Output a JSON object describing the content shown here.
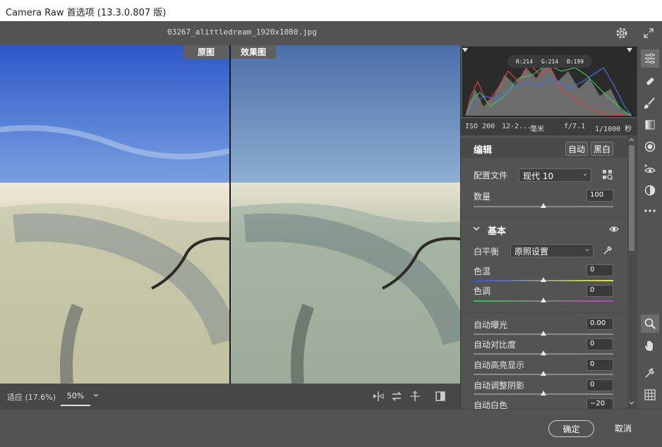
{
  "window": {
    "title": "Camera Raw 首选项  (13.3.0.807 版)"
  },
  "topbar": {
    "filename": "03267_alittledream_1920x1080.jpg",
    "icons": [
      "gear-icon",
      "expand-icon"
    ]
  },
  "preview": {
    "before_label": "原图",
    "after_label": "效果图"
  },
  "bottombar": {
    "fit_label": "适应 (17.6%)",
    "zoom_value": "50%"
  },
  "histogram": {
    "r": "R:214",
    "g": "G:214",
    "b": "B:199"
  },
  "camera_info": {
    "iso": "ISO 200",
    "lens": "12-2...",
    "focal": "毫米",
    "aperture": "f/7.1",
    "shutter": "1/1000 秒"
  },
  "edit": {
    "title": "编辑",
    "auto_label": "自动",
    "bw_label": "黑白",
    "profile_label": "配置文件",
    "profile_value": "现代 10",
    "amount_label": "数量",
    "amount_value": "100"
  },
  "basic": {
    "title": "基本",
    "wb_label": "白平衡",
    "wb_value": "原照设置",
    "temp_label": "色温",
    "temp_value": "0",
    "tint_label": "色调",
    "tint_value": "0",
    "sliders": [
      {
        "label": "自动曝光",
        "value": "0.00"
      },
      {
        "label": "自动对比度",
        "value": "0"
      },
      {
        "label": "自动高亮显示",
        "value": "0"
      },
      {
        "label": "自动调整阴影",
        "value": "0"
      },
      {
        "label": "自动白色",
        "value": "−20"
      }
    ]
  },
  "footer": {
    "ok_label": "确定",
    "cancel_label": "取消"
  },
  "colors": {
    "panel": "#535353",
    "accent": "#ffffff",
    "histo_bg": "#2b2b2b"
  }
}
